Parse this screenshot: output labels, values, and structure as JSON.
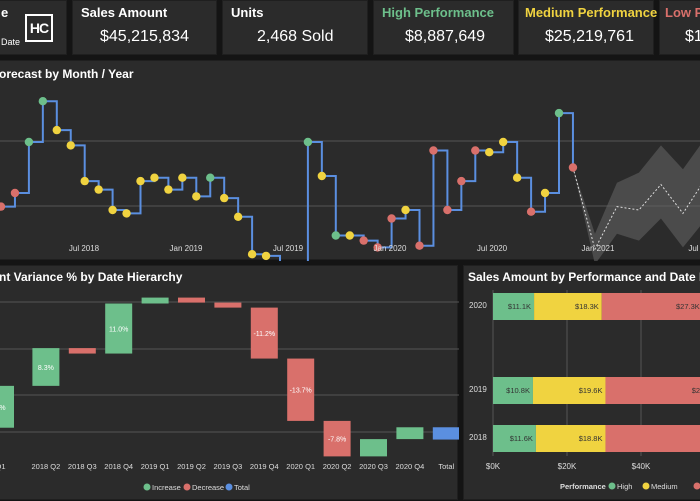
{
  "colors": {
    "background": "#141414",
    "panel": "#2b2b2b",
    "high": "#6dbf8b",
    "medium": "#f0d340",
    "low": "#d9706b",
    "increase": "#6dbf8b",
    "decrease": "#d9706b",
    "total": "#5b8fe0",
    "line": "#5b8fe0"
  },
  "header": {
    "logo_text": "HC",
    "date_label": "Date",
    "partial_label": "e"
  },
  "cards": [
    {
      "title": "Sales Amount",
      "value": "$45,215,834"
    },
    {
      "title": "Units",
      "value": "2,468 Sold"
    },
    {
      "title": "High Performance",
      "value": "$8,887,649"
    },
    {
      "title": "Medium Performance",
      "value": "$25,219,761"
    },
    {
      "title": "Low Pe",
      "value": "$1"
    }
  ],
  "forecast": {
    "title": "orecast by Month / Year",
    "x_labels": [
      "Jul 2018",
      "Jan 2019",
      "Jul 2019",
      "Jan 2020",
      "Jul 2020",
      "Jan 2021",
      "Jul 20"
    ]
  },
  "waterfall": {
    "title": "nt Variance % by Date Hierarchy",
    "legend": [
      "Increase",
      "Decrease",
      "Total"
    ]
  },
  "performance": {
    "title": "Sales Amount by Performance and Date Hie",
    "legend_title": "Performance",
    "legend": [
      "High",
      "Medium",
      "Low"
    ]
  },
  "chart_data": [
    {
      "type": "line",
      "title": "",
      "x_tick_labels": [
        "Jul 2018",
        "Jan 2019",
        "Jul 2019",
        "Jan 2020",
        "Jul 2020",
        "Jan 2021",
        "Jul 20"
      ],
      "series": [
        {
          "color": "#5b8fe0",
          "points": [
            {
              "y": 6.8,
              "c": "low"
            },
            {
              "y": 6.0,
              "c": "low"
            },
            {
              "y": 3.0,
              "c": "high"
            },
            {
              "y": 0.6,
              "c": "high"
            },
            {
              "y": 2.3,
              "c": "medium"
            },
            {
              "y": 3.2,
              "c": "medium"
            },
            {
              "y": 5.3,
              "c": "medium"
            },
            {
              "y": 5.8,
              "c": "medium"
            },
            {
              "y": 7.0,
              "c": "medium"
            },
            {
              "y": 7.2,
              "c": "medium"
            },
            {
              "y": 5.3,
              "c": "medium"
            },
            {
              "y": 5.1,
              "c": "medium"
            },
            {
              "y": 5.8,
              "c": "medium"
            },
            {
              "y": 5.1,
              "c": "medium"
            },
            {
              "y": 6.2,
              "c": "medium"
            },
            {
              "y": 5.1,
              "c": "high"
            },
            {
              "y": 6.3,
              "c": "medium"
            },
            {
              "y": 7.4,
              "c": "medium"
            },
            {
              "y": 9.6,
              "c": "medium"
            },
            {
              "y": 9.7,
              "c": "medium"
            },
            {
              "y": 10.8,
              "c": "low"
            },
            {
              "y": 10.6,
              "c": "medium"
            },
            {
              "y": 3.0,
              "c": "high"
            },
            {
              "y": 5.0,
              "c": "medium"
            },
            {
              "y": 8.5,
              "c": "high"
            },
            {
              "y": 8.5,
              "c": "medium"
            },
            {
              "y": 8.8,
              "c": "low"
            },
            {
              "y": 9.2,
              "c": "low"
            },
            {
              "y": 7.5,
              "c": "low"
            },
            {
              "y": 7.0,
              "c": "medium"
            },
            {
              "y": 9.1,
              "c": "low"
            },
            {
              "y": 3.5,
              "c": "low"
            },
            {
              "y": 7.0,
              "c": "low"
            },
            {
              "y": 5.3,
              "c": "low"
            },
            {
              "y": 3.5,
              "c": "low"
            },
            {
              "y": 3.6,
              "c": "medium"
            },
            {
              "y": 3.0,
              "c": "medium"
            },
            {
              "y": 5.1,
              "c": "medium"
            },
            {
              "y": 7.1,
              "c": "low"
            },
            {
              "y": 6.0,
              "c": "medium"
            },
            {
              "y": 1.3,
              "c": "high"
            },
            {
              "y": 4.5,
              "c": "low"
            }
          ]
        }
      ],
      "forecast_band": {
        "mid": [
          9.3,
          6.8,
          7.0,
          5.5,
          7.2,
          5.2
        ],
        "upper": [
          8.4,
          5.4,
          4.8,
          3.2,
          4.6,
          2.8
        ],
        "lower": [
          10.2,
          8.4,
          8.8,
          7.5,
          9.2,
          7.6
        ]
      }
    },
    {
      "type": "bar",
      "title": "",
      "categories": [
        "Q1",
        "2018 Q2",
        "2018 Q3",
        "2018 Q4",
        "2019 Q1",
        "2019 Q2",
        "2019 Q3",
        "2019 Q4",
        "2020 Q1",
        "2020 Q2",
        "2020 Q3",
        "2020 Q4",
        "Total"
      ],
      "values": [
        null,
        8.3,
        null,
        11.0,
        null,
        null,
        null,
        -11.2,
        -13.7,
        -7.8,
        null,
        null,
        null
      ],
      "labels": [
        "%",
        "8.3%",
        "",
        "11.0%",
        "",
        "",
        "",
        "-11.2%",
        "-13.7%",
        "-7.8%",
        "",
        "",
        ""
      ],
      "kinds": [
        "increase",
        "increase",
        "decrease",
        "increase",
        "increase",
        "decrease",
        "decrease",
        "decrease",
        "decrease",
        "decrease",
        "increase",
        "increase",
        "total"
      ],
      "legend": [
        "Increase",
        "Decrease",
        "Total"
      ]
    },
    {
      "type": "bar",
      "orientation": "horizontal-stacked",
      "title": "",
      "categories": [
        "2020",
        "2019",
        "2018"
      ],
      "series": [
        {
          "name": "High",
          "values": [
            11.1,
            10.8,
            11.6
          ],
          "labels": [
            "$11.1K",
            "$10.8K",
            "$11.6K"
          ]
        },
        {
          "name": "Medium",
          "values": [
            18.3,
            19.6,
            18.8
          ],
          "labels": [
            "$18.3K",
            "$19.6K",
            "$18.8K"
          ]
        },
        {
          "name": "Low",
          "values": [
            27.3,
            29.2,
            28.5
          ],
          "labels": [
            "$27.3K",
            "$29.2",
            ""
          ]
        }
      ],
      "x_tick_labels": [
        "$0K",
        "$20K",
        "$40K"
      ],
      "legend_title": "Performance"
    }
  ]
}
